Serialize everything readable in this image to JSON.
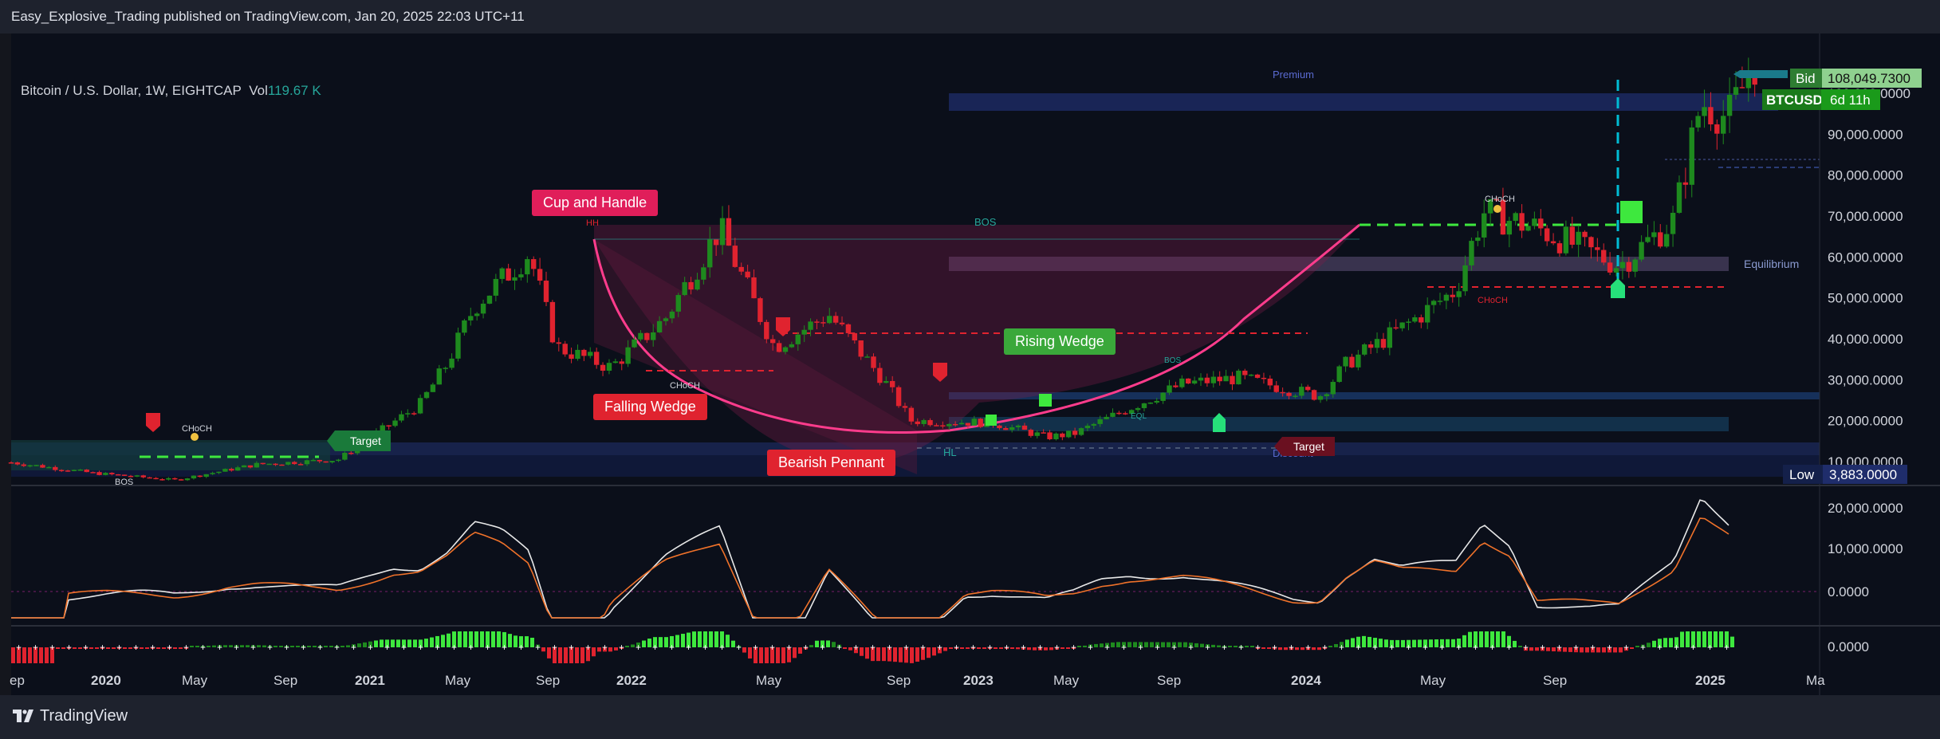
{
  "header": {
    "publish_text": "Easy_Explosive_Trading published on TradingView.com, Jan 20, 2025 22:03 UTC+11"
  },
  "symbol": {
    "name": "Bitcoin / U.S. Dollar, 1W, EIGHTCAP",
    "vol_label": "Vol",
    "vol_value": "119.67 K"
  },
  "price_tags": {
    "bid_label": "Bid",
    "bid_value": "108,049.7300",
    "ticker": "BTCUSD",
    "countdown": "6d 11h",
    "low_label": "Low",
    "low_value": "3,883.0000",
    "target": "Target"
  },
  "patterns": {
    "cup_handle": "Cup and Handle",
    "falling_wedge": "Falling Wedge",
    "bearish_pennant": "Bearish Pennant",
    "rising_wedge": "Rising Wedge"
  },
  "annotations": {
    "hh": "HH",
    "bos": "BOS",
    "choch": "CHoCH",
    "hl": "HL",
    "eql": "EQL",
    "target": "Target",
    "premium": "Premium",
    "equilibrium": "Equilibrium",
    "discount": "Discount"
  },
  "footer": {
    "brand": "TradingView"
  },
  "colors": {
    "up": "#1e8a1e",
    "down": "#e0232f",
    "bright_up": "#3ee83e",
    "pink": "#ff3c8c",
    "bg": "#0b0f1a"
  },
  "chart_data": {
    "type": "candlestick",
    "title": "Bitcoin / U.S. Dollar, 1W, EIGHTCAP",
    "ylim": [
      0,
      110000
    ],
    "y_ticks": [
      "100,000.0000",
      "90,000.0000",
      "80,000.0000",
      "70,000.0000",
      "60,000.0000",
      "50,000.0000",
      "40,000.0000",
      "30,000.0000",
      "20,000.0000",
      "10,000.0000"
    ],
    "x_ticks": [
      "ep",
      "2020",
      "May",
      "Sep",
      "2021",
      "May",
      "Sep",
      "2022",
      "May",
      "Sep",
      "2023",
      "May",
      "Sep",
      "2024",
      "May",
      "Sep",
      "2025",
      "Ma"
    ],
    "x_range": [
      "2019-09",
      "2025-03"
    ],
    "weekly_close_approx": [
      [
        "2019-09",
        9800
      ],
      [
        "2019-12",
        7200
      ],
      [
        "2020-03",
        5500
      ],
      [
        "2020-06",
        9300
      ],
      [
        "2020-09",
        10500
      ],
      [
        "2020-12",
        24000
      ],
      [
        "2021-01",
        34000
      ],
      [
        "2021-02",
        48000
      ],
      [
        "2021-04",
        61000
      ],
      [
        "2021-05",
        38000
      ],
      [
        "2021-07",
        33000
      ],
      [
        "2021-09",
        45000
      ],
      [
        "2021-11",
        67000
      ],
      [
        "2022-01",
        38000
      ],
      [
        "2022-03",
        46000
      ],
      [
        "2022-05",
        30000
      ],
      [
        "2022-06",
        20000
      ],
      [
        "2022-09",
        19500
      ],
      [
        "2022-11",
        16000
      ],
      [
        "2022-12",
        16800
      ],
      [
        "2023-02",
        23000
      ],
      [
        "2023-04",
        29000
      ],
      [
        "2023-06",
        30500
      ],
      [
        "2023-09",
        26000
      ],
      [
        "2023-10",
        34000
      ],
      [
        "2023-12",
        42500
      ],
      [
        "2024-02",
        52000
      ],
      [
        "2024-03",
        71000
      ],
      [
        "2024-05",
        67000
      ],
      [
        "2024-08",
        58000
      ],
      [
        "2024-10",
        69000
      ],
      [
        "2024-11",
        98000
      ],
      [
        "2024-12",
        94000
      ],
      [
        "2025-01",
        108000
      ]
    ],
    "indicator_panel": {
      "y_ticks": [
        "20,000.0000",
        "10,000.0000",
        "0.0000"
      ],
      "series": [
        {
          "name": "",
          "color": "#ffffff"
        },
        {
          "name": "",
          "color": "#f0722a"
        }
      ]
    },
    "histogram_panel": {
      "y_ticks": [
        "0.0000"
      ]
    }
  }
}
